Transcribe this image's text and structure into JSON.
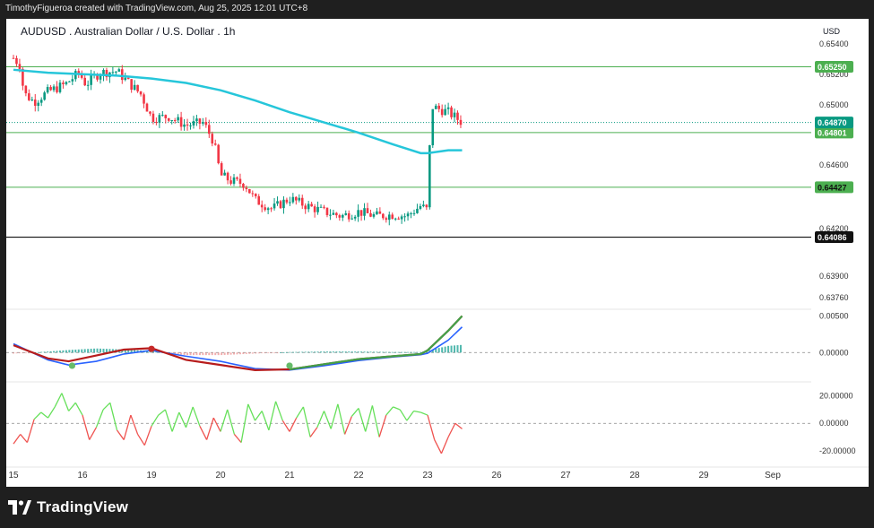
{
  "header": {
    "credit": "TimothyFigueroa created with TradingView.com, Aug 25, 2025 12:01 UTC+8"
  },
  "brand": {
    "name": "TradingView"
  },
  "chart_data": {
    "type": "candlestick",
    "title": "AUDUSD . Australian Dollar / U.S. Dollar . 1h",
    "currency": "USD",
    "ylim": [
      0.6363,
      0.6548
    ],
    "y_ticks": [
      "0.65400",
      "0.65200",
      "0.65000",
      "0.64600",
      "0.64200",
      "0.63900",
      "0.63760"
    ],
    "x_ticks": [
      "15",
      "16",
      "19",
      "20",
      "21",
      "22",
      "23",
      "26",
      "27",
      "28",
      "29",
      "Sep"
    ],
    "x_range_days": [
      0,
      11.2
    ],
    "x_tick_positions_days": [
      0,
      1,
      2,
      3,
      4,
      5,
      6,
      7,
      8,
      9,
      10,
      11
    ],
    "price_path_days": [
      0,
      0.1,
      0.15,
      0.3,
      0.5,
      0.75,
      0.95,
      1.05,
      1.25,
      1.5,
      1.65,
      1.85,
      2.0,
      2.25,
      2.5,
      2.75,
      2.9,
      3.0,
      3.15,
      3.35,
      3.5,
      3.75,
      4.0,
      4.25,
      4.5,
      4.75,
      5.0,
      5.25,
      5.5,
      5.7,
      5.9,
      6.0,
      6.05,
      6.3,
      6.5
    ],
    "price_path": [
      0.6531,
      0.6526,
      0.6507,
      0.6501,
      0.6508,
      0.6513,
      0.6521,
      0.6513,
      0.6521,
      0.6522,
      0.6515,
      0.6506,
      0.649,
      0.6491,
      0.6485,
      0.6487,
      0.6474,
      0.6451,
      0.6447,
      0.6445,
      0.6434,
      0.6428,
      0.6435,
      0.643,
      0.6426,
      0.6423,
      0.6426,
      0.6423,
      0.6424,
      0.6423,
      0.643,
      0.6427,
      0.6498,
      0.6494,
      0.6487
    ],
    "ma_days": [
      0,
      0.5,
      1.0,
      1.5,
      2.0,
      2.5,
      3.0,
      3.5,
      4.0,
      4.5,
      5.0,
      5.5,
      5.9,
      6.0,
      6.3,
      6.5
    ],
    "ma_values": [
      0.6523,
      0.6521,
      0.652,
      0.6519,
      0.6517,
      0.6514,
      0.6509,
      0.6502,
      0.6494,
      0.6487,
      0.648,
      0.6472,
      0.6466,
      0.6466,
      0.6468,
      0.6468
    ],
    "horizontal_levels": [
      {
        "label": "0.65250",
        "value": 0.6525,
        "color": "#4caf50",
        "text_color": "#ffffff"
      },
      {
        "label": "0.64801",
        "value": 0.64801,
        "color": "#4caf50",
        "text_color": "#ffffff"
      },
      {
        "label": "0.64427",
        "value": 0.64427,
        "color": "#4caf50",
        "text_color": "#111111"
      },
      {
        "label": "0.64086",
        "value": 0.64086,
        "color": "#111111",
        "text_color": "#ffffff"
      }
    ],
    "last_price": {
      "label": "0.64870",
      "value": 0.6487,
      "color": "#089981"
    },
    "macd": {
      "ylim": [
        -0.0034,
        0.0058
      ],
      "ticks": [
        "0.00500",
        "0.00000"
      ],
      "tick_values": [
        0.005,
        0
      ],
      "days": [
        0,
        0.5,
        0.8,
        1.2,
        1.6,
        2.0,
        2.5,
        3.0,
        3.5,
        4.0,
        4.5,
        5.0,
        5.5,
        5.9,
        6.0,
        6.3,
        6.5
      ],
      "macd_line": [
        0.001,
        -0.0008,
        -0.0012,
        -0.0004,
        0.0004,
        0.0006,
        -0.001,
        -0.0017,
        -0.0024,
        -0.0023,
        -0.0016,
        -0.0009,
        -0.0005,
        -0.0002,
        0.0003,
        0.003,
        0.005
      ],
      "signal_line": [
        0.0012,
        -0.001,
        -0.0017,
        -0.0012,
        -0.0002,
        0.0003,
        -0.0005,
        -0.0012,
        -0.0022,
        -0.0024,
        -0.0018,
        -0.0011,
        -0.0006,
        -0.0003,
        -0.0001,
        0.0017,
        0.0035
      ],
      "cross_markers": [
        {
          "day": 0.85,
          "value": -0.0018,
          "color": "#66bb6a"
        },
        {
          "day": 2.0,
          "value": 0.0005,
          "color": "#c62828"
        },
        {
          "day": 4.0,
          "value": -0.0018,
          "color": "#66bb6a"
        }
      ]
    },
    "momentum": {
      "ylim": [
        -28,
        27
      ],
      "ticks": [
        "20.00000",
        "0.00000",
        "-20.00000"
      ],
      "tick_values": [
        20,
        0,
        -20
      ],
      "days": [
        0,
        0.1,
        0.2,
        0.3,
        0.4,
        0.5,
        0.6,
        0.7,
        0.8,
        0.9,
        1.0,
        1.1,
        1.2,
        1.3,
        1.4,
        1.5,
        1.6,
        1.7,
        1.8,
        1.9,
        2.0,
        2.1,
        2.2,
        2.3,
        2.4,
        2.5,
        2.6,
        2.7,
        2.8,
        2.9,
        3.0,
        3.1,
        3.2,
        3.3,
        3.4,
        3.5,
        3.6,
        3.7,
        3.8,
        3.9,
        4.0,
        4.1,
        4.2,
        4.3,
        4.4,
        4.5,
        4.6,
        4.7,
        4.8,
        4.9,
        5.0,
        5.1,
        5.2,
        5.3,
        5.4,
        5.5,
        5.6,
        5.7,
        5.8,
        5.9,
        6.0,
        6.1,
        6.2,
        6.3,
        6.4,
        6.5
      ],
      "values": [
        -15,
        -8,
        -14,
        3,
        8,
        4,
        12,
        22,
        9,
        15,
        6,
        -12,
        -3,
        10,
        15,
        -5,
        -12,
        6,
        -8,
        -16,
        -2,
        6,
        10,
        -6,
        8,
        -3,
        12,
        -2,
        -12,
        4,
        -6,
        10,
        -8,
        -14,
        14,
        2,
        9,
        -5,
        16,
        2,
        -6,
        4,
        12,
        -10,
        -3,
        9,
        -4,
        14,
        -8,
        5,
        11,
        -6,
        13,
        -10,
        6,
        12,
        10,
        2,
        9,
        8,
        6,
        -12,
        -22,
        -10,
        0,
        -4
      ]
    }
  }
}
